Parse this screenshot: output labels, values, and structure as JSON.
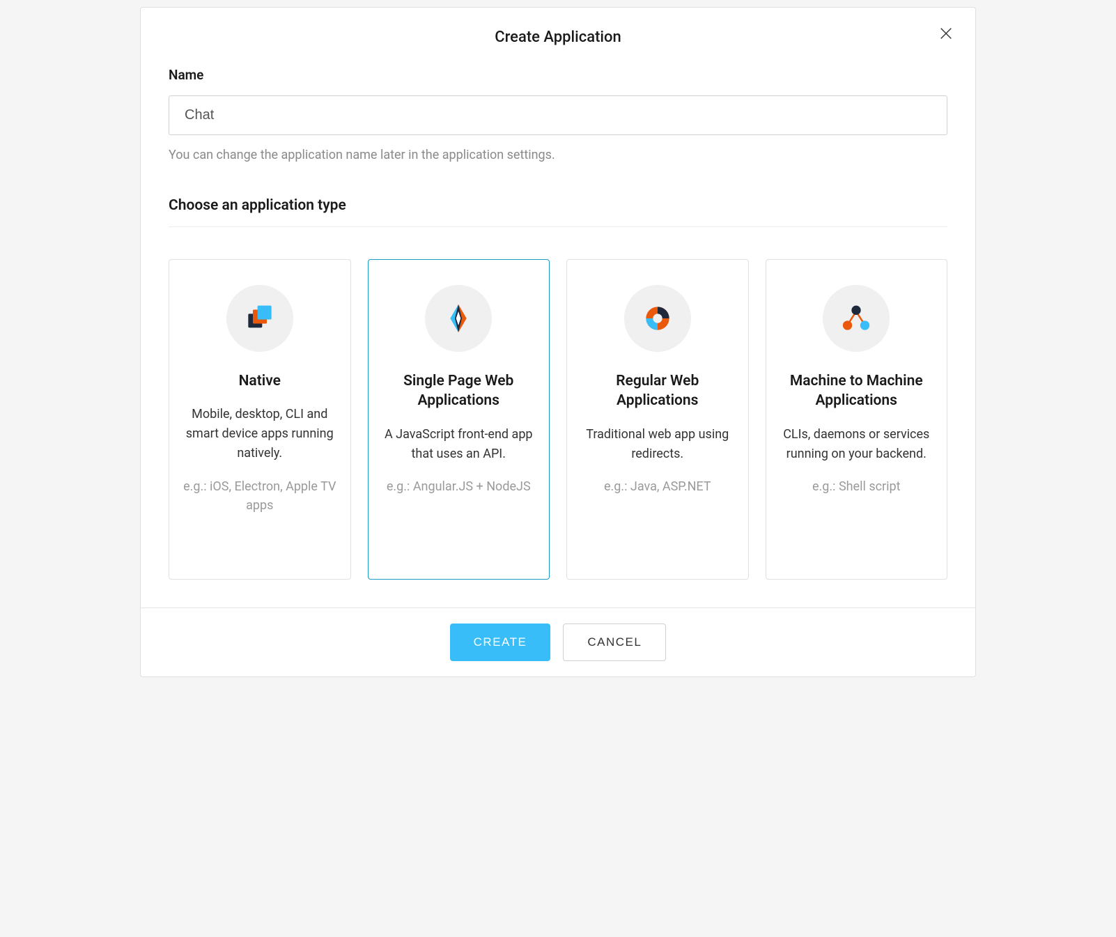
{
  "modal": {
    "title": "Create Application",
    "name_label": "Name",
    "name_value": "Chat",
    "name_help": "You can change the application name later in the application settings.",
    "type_section_title": "Choose an application type",
    "selected_type_index": 1,
    "types": [
      {
        "icon": "native-icon",
        "title": "Native",
        "description": "Mobile, desktop, CLI and smart device apps running natively.",
        "example": "e.g.: iOS, Electron, Apple TV apps"
      },
      {
        "icon": "spa-icon",
        "title": "Single Page Web Applications",
        "description": "A JavaScript front-end app that uses an API.",
        "example": "e.g.: Angular.JS + NodeJS"
      },
      {
        "icon": "regular-web-icon",
        "title": "Regular Web Applications",
        "description": "Traditional web app using redirects.",
        "example": "e.g.: Java, ASP.NET"
      },
      {
        "icon": "m2m-icon",
        "title": "Machine to Machine Applications",
        "description": "CLIs, daemons or services running on your backend.",
        "example": "e.g.: Shell script"
      }
    ],
    "buttons": {
      "create": "CREATE",
      "cancel": "CANCEL"
    }
  },
  "colors": {
    "accent": "#38bdf8",
    "selected_border": "#1a9cc7",
    "orange": "#ea580c",
    "navy": "#1e293b",
    "sky": "#38bdf8"
  }
}
